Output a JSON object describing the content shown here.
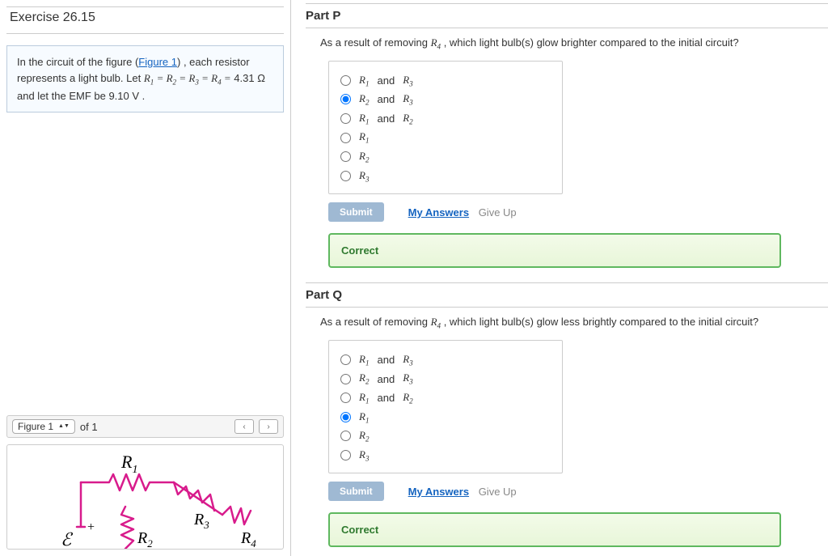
{
  "exercise_title": "Exercise 26.15",
  "intro": {
    "pre": "In the circuit of the figure (",
    "figure_link": "Figure 1",
    "post": ") , each resistor represents a light bulb. Let ",
    "eq_text": "R₁ = R₂ = R₃ = R₄ =",
    "value_line": "4.31 Ω and let the EMF be 9.10 V ."
  },
  "figure_bar": {
    "label": "Figure 1",
    "of_text": "of 1"
  },
  "partP": {
    "title": "Part P",
    "question_pre": "As a result of removing ",
    "question_var": "R₄",
    "question_post": ", which light bulb(s) glow brighter compared to the initial circuit?",
    "options": [
      "R₁ and R₃",
      "R₂ and R₃",
      "R₁ and R₂",
      "R₁",
      "R₂",
      "R₃"
    ],
    "selected_index": 1,
    "submit": "Submit",
    "my_answers": "My Answers",
    "give_up": "Give Up",
    "correct": "Correct"
  },
  "partQ": {
    "title": "Part Q",
    "question_pre": "As a result of removing ",
    "question_var": "R₄",
    "question_post": ", which light bulb(s) glow less brightly compared to the initial circuit?",
    "options": [
      "R₁ and R₃",
      "R₂ and R₃",
      "R₁ and R₂",
      "R₁",
      "R₂",
      "R₃"
    ],
    "selected_index": 3,
    "submit": "Submit",
    "my_answers": "My Answers",
    "give_up": "Give Up",
    "correct": "Correct"
  },
  "circuit_labels": {
    "r1": "R",
    "r1sub": "1",
    "r2": "R",
    "r2sub": "2",
    "r3": "R",
    "r3sub": "3",
    "r4": "R",
    "r4sub": "4",
    "emf": "ℰ",
    "plus": "+"
  }
}
